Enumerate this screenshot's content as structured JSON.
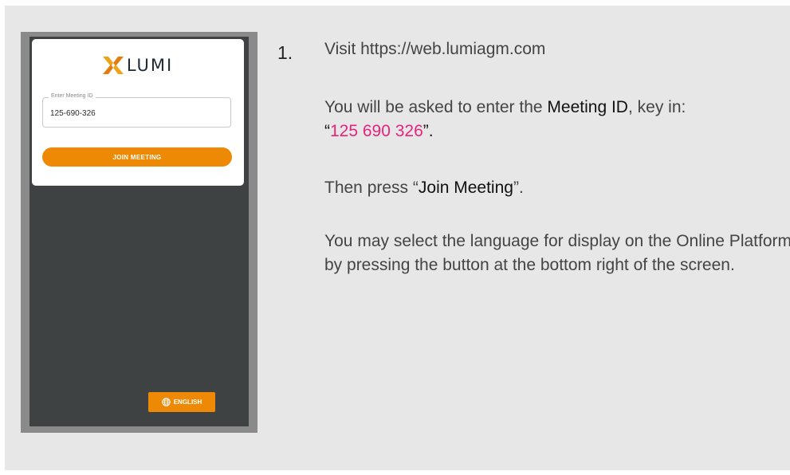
{
  "phone": {
    "brand": "LUMI",
    "field_label": "Enter Meeting ID",
    "field_value": "125-690-326",
    "join_label": "JOIN MEETING",
    "language_label": "ENGLISH"
  },
  "instructions": {
    "step_number": "1.",
    "visit_text": "Visit https://web.lumiagm.com",
    "asked_prefix": "You will be asked to enter the ",
    "meeting_id_word": "Meeting ID",
    "asked_suffix": ", key in:",
    "open_quote": "“",
    "meeting_id_value": "125 690 326",
    "close_quote": "”.",
    "press_prefix": "Then press “",
    "press_bold": "Join Meeting",
    "press_suffix": "”.",
    "language_text": "You may select the language for display on the Online Platform by pressing the button at the bottom right of the screen."
  },
  "colors": {
    "accent_orange": "#ee8905",
    "highlight_pink": "#e8237b",
    "phone_dark": "#3f4242",
    "panel_bg": "#e7e7e7"
  },
  "icons": {
    "logo": "lumi-x-logo",
    "language": "globe-icon"
  }
}
